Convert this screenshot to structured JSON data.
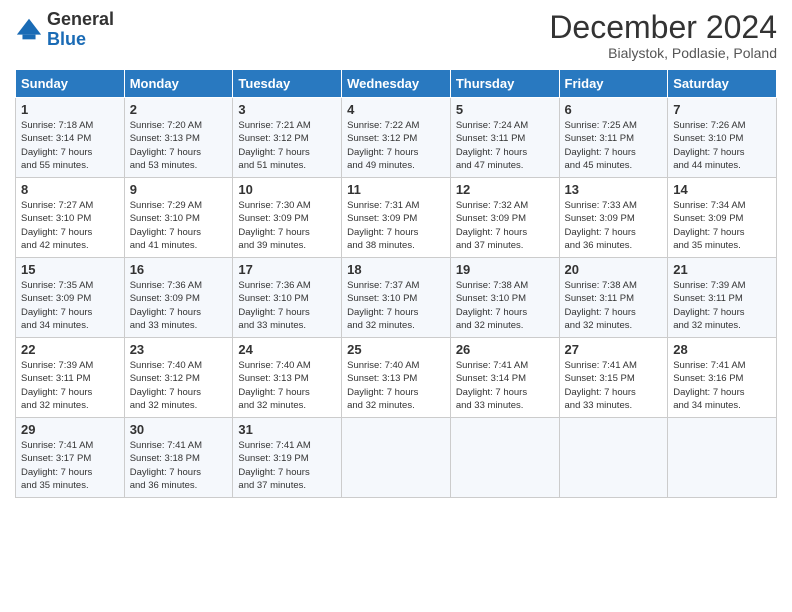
{
  "header": {
    "logo_line1": "General",
    "logo_line2": "Blue",
    "month": "December 2024",
    "location": "Bialystok, Podlasie, Poland"
  },
  "weekdays": [
    "Sunday",
    "Monday",
    "Tuesday",
    "Wednesday",
    "Thursday",
    "Friday",
    "Saturday"
  ],
  "weeks": [
    [
      {
        "day": "1",
        "info": "Sunrise: 7:18 AM\nSunset: 3:14 PM\nDaylight: 7 hours\nand 55 minutes."
      },
      {
        "day": "2",
        "info": "Sunrise: 7:20 AM\nSunset: 3:13 PM\nDaylight: 7 hours\nand 53 minutes."
      },
      {
        "day": "3",
        "info": "Sunrise: 7:21 AM\nSunset: 3:12 PM\nDaylight: 7 hours\nand 51 minutes."
      },
      {
        "day": "4",
        "info": "Sunrise: 7:22 AM\nSunset: 3:12 PM\nDaylight: 7 hours\nand 49 minutes."
      },
      {
        "day": "5",
        "info": "Sunrise: 7:24 AM\nSunset: 3:11 PM\nDaylight: 7 hours\nand 47 minutes."
      },
      {
        "day": "6",
        "info": "Sunrise: 7:25 AM\nSunset: 3:11 PM\nDaylight: 7 hours\nand 45 minutes."
      },
      {
        "day": "7",
        "info": "Sunrise: 7:26 AM\nSunset: 3:10 PM\nDaylight: 7 hours\nand 44 minutes."
      }
    ],
    [
      {
        "day": "8",
        "info": "Sunrise: 7:27 AM\nSunset: 3:10 PM\nDaylight: 7 hours\nand 42 minutes."
      },
      {
        "day": "9",
        "info": "Sunrise: 7:29 AM\nSunset: 3:10 PM\nDaylight: 7 hours\nand 41 minutes."
      },
      {
        "day": "10",
        "info": "Sunrise: 7:30 AM\nSunset: 3:09 PM\nDaylight: 7 hours\nand 39 minutes."
      },
      {
        "day": "11",
        "info": "Sunrise: 7:31 AM\nSunset: 3:09 PM\nDaylight: 7 hours\nand 38 minutes."
      },
      {
        "day": "12",
        "info": "Sunrise: 7:32 AM\nSunset: 3:09 PM\nDaylight: 7 hours\nand 37 minutes."
      },
      {
        "day": "13",
        "info": "Sunrise: 7:33 AM\nSunset: 3:09 PM\nDaylight: 7 hours\nand 36 minutes."
      },
      {
        "day": "14",
        "info": "Sunrise: 7:34 AM\nSunset: 3:09 PM\nDaylight: 7 hours\nand 35 minutes."
      }
    ],
    [
      {
        "day": "15",
        "info": "Sunrise: 7:35 AM\nSunset: 3:09 PM\nDaylight: 7 hours\nand 34 minutes."
      },
      {
        "day": "16",
        "info": "Sunrise: 7:36 AM\nSunset: 3:09 PM\nDaylight: 7 hours\nand 33 minutes."
      },
      {
        "day": "17",
        "info": "Sunrise: 7:36 AM\nSunset: 3:10 PM\nDaylight: 7 hours\nand 33 minutes."
      },
      {
        "day": "18",
        "info": "Sunrise: 7:37 AM\nSunset: 3:10 PM\nDaylight: 7 hours\nand 32 minutes."
      },
      {
        "day": "19",
        "info": "Sunrise: 7:38 AM\nSunset: 3:10 PM\nDaylight: 7 hours\nand 32 minutes."
      },
      {
        "day": "20",
        "info": "Sunrise: 7:38 AM\nSunset: 3:11 PM\nDaylight: 7 hours\nand 32 minutes."
      },
      {
        "day": "21",
        "info": "Sunrise: 7:39 AM\nSunset: 3:11 PM\nDaylight: 7 hours\nand 32 minutes."
      }
    ],
    [
      {
        "day": "22",
        "info": "Sunrise: 7:39 AM\nSunset: 3:11 PM\nDaylight: 7 hours\nand 32 minutes."
      },
      {
        "day": "23",
        "info": "Sunrise: 7:40 AM\nSunset: 3:12 PM\nDaylight: 7 hours\nand 32 minutes."
      },
      {
        "day": "24",
        "info": "Sunrise: 7:40 AM\nSunset: 3:13 PM\nDaylight: 7 hours\nand 32 minutes."
      },
      {
        "day": "25",
        "info": "Sunrise: 7:40 AM\nSunset: 3:13 PM\nDaylight: 7 hours\nand 32 minutes."
      },
      {
        "day": "26",
        "info": "Sunrise: 7:41 AM\nSunset: 3:14 PM\nDaylight: 7 hours\nand 33 minutes."
      },
      {
        "day": "27",
        "info": "Sunrise: 7:41 AM\nSunset: 3:15 PM\nDaylight: 7 hours\nand 33 minutes."
      },
      {
        "day": "28",
        "info": "Sunrise: 7:41 AM\nSunset: 3:16 PM\nDaylight: 7 hours\nand 34 minutes."
      }
    ],
    [
      {
        "day": "29",
        "info": "Sunrise: 7:41 AM\nSunset: 3:17 PM\nDaylight: 7 hours\nand 35 minutes."
      },
      {
        "day": "30",
        "info": "Sunrise: 7:41 AM\nSunset: 3:18 PM\nDaylight: 7 hours\nand 36 minutes."
      },
      {
        "day": "31",
        "info": "Sunrise: 7:41 AM\nSunset: 3:19 PM\nDaylight: 7 hours\nand 37 minutes."
      },
      {
        "day": "",
        "info": ""
      },
      {
        "day": "",
        "info": ""
      },
      {
        "day": "",
        "info": ""
      },
      {
        "day": "",
        "info": ""
      }
    ]
  ]
}
